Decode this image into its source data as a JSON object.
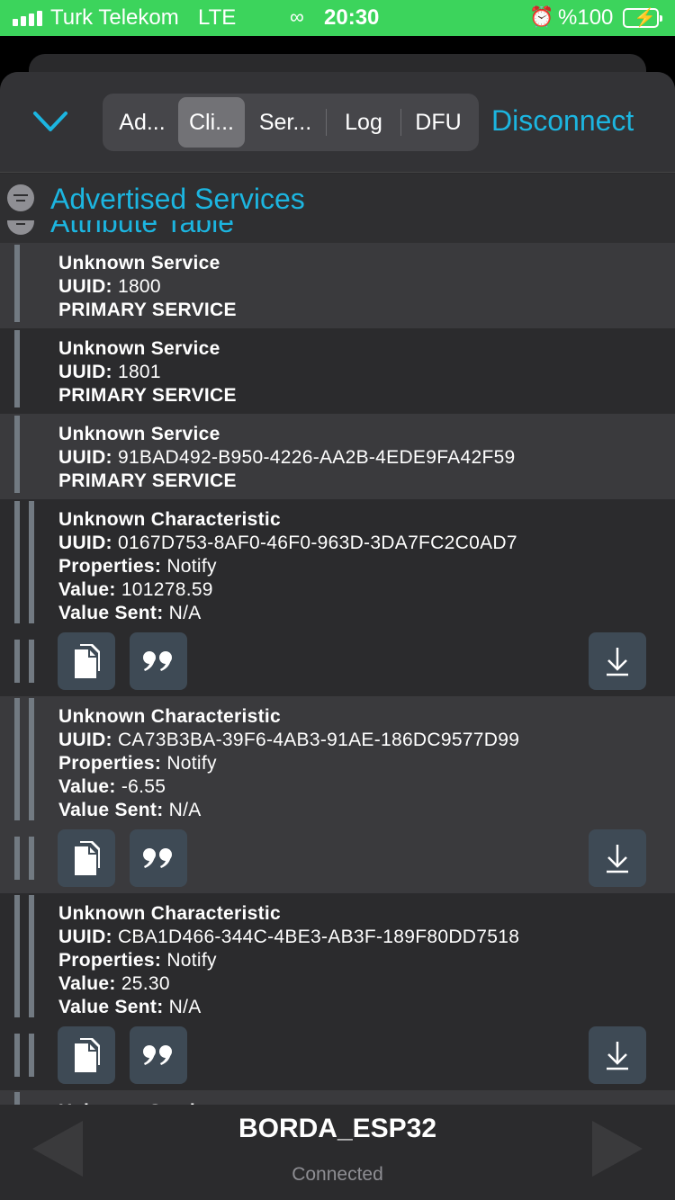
{
  "status_bar": {
    "carrier": "Turk Telekom",
    "network": "LTE",
    "time": "20:30",
    "battery": "%100"
  },
  "toolbar": {
    "tabs": [
      "Ad...",
      "Cli...",
      "Ser...",
      "Log",
      "DFU"
    ],
    "selected_tab": "Cli...",
    "disconnect_label": "Disconnect",
    "accent_color": "#1cb5e0"
  },
  "sections": {
    "advertised": "Advertised Services",
    "attribute": "Attribute Table"
  },
  "labels": {
    "uuid": "UUID:",
    "properties": "Properties:",
    "value": "Value:",
    "value_sent": "Value Sent:",
    "partial_row": "Unknown Service"
  },
  "services": [
    {
      "name": "Unknown Service",
      "uuid": "1800",
      "type": "PRIMARY SERVICE"
    },
    {
      "name": "Unknown Service",
      "uuid": "1801",
      "type": "PRIMARY SERVICE"
    },
    {
      "name": "Unknown Service",
      "uuid": "91BAD492-B950-4226-AA2B-4EDE9FA42F59",
      "type": "PRIMARY SERVICE"
    }
  ],
  "characteristics": [
    {
      "name": "Unknown Characteristic",
      "uuid": "0167D753-8AF0-46F0-963D-3DA7FC2C0AD7",
      "properties": "Notify",
      "value": "101278.59",
      "value_sent": "N/A"
    },
    {
      "name": "Unknown Characteristic",
      "uuid": "CA73B3BA-39F6-4AB3-91AE-186DC9577D99",
      "properties": "Notify",
      "value": " -6.55",
      "value_sent": "N/A"
    },
    {
      "name": "Unknown Characteristic",
      "uuid": "CBA1D466-344C-4BE3-AB3F-189F80DD7518",
      "properties": "Notify",
      "value": " 25.30",
      "value_sent": "N/A"
    }
  ],
  "footer": {
    "device_name": "BORDA_ESP32",
    "device_status": "Connected"
  },
  "icons": [
    "chevron-down-icon",
    "filter-icon",
    "copy-icon",
    "quote-icon",
    "download-icon",
    "previous-arrow-icon",
    "next-arrow-icon"
  ]
}
